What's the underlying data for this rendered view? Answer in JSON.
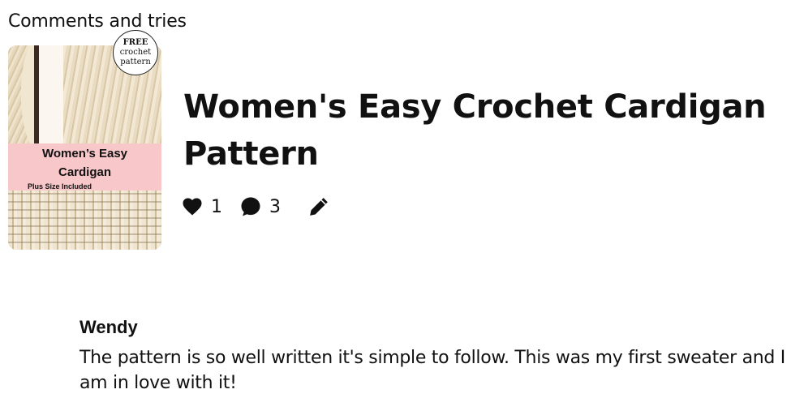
{
  "section": {
    "title": "Comments and tries"
  },
  "pin": {
    "image": {
      "badge_line1": "FREE",
      "badge_line2": "crochet",
      "badge_line3": "pattern",
      "band_line1": "Women’s Easy",
      "band_line2": "Cardigan",
      "band_line3": "Plus Size Included",
      "band_color": "#f7c7c9"
    },
    "title": "Women's Easy Crochet Cardigan Pattern",
    "likes": {
      "icon": "heart-icon",
      "count": "1"
    },
    "comments": {
      "icon": "comment-icon",
      "count": "3"
    },
    "edit": {
      "icon": "pencil-icon"
    }
  },
  "comment": {
    "author": "Wendy",
    "text": "The pattern is so well written it's simple to follow. This was my first sweater and I am in love with it!"
  }
}
